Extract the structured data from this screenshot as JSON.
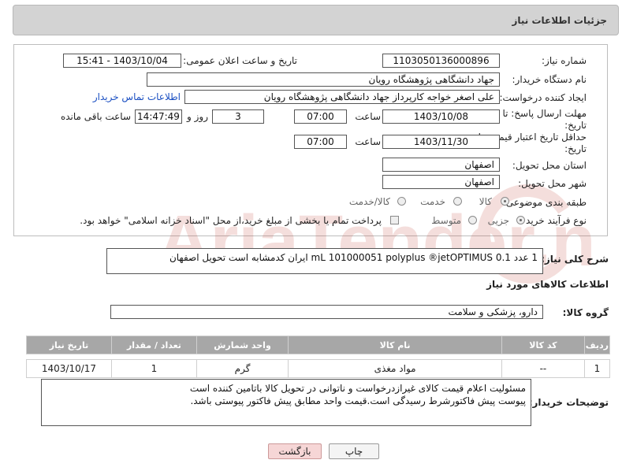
{
  "header": {
    "title": "جزئیات اطلاعات نیاز"
  },
  "form": {
    "need_number_label": "شماره نیاز:",
    "need_number": "1103050136000896",
    "announce_datetime_label": "تاریخ و ساعت اعلان عمومی:",
    "announce_datetime": "1403/10/04 - 15:41",
    "buyer_org_label": "نام دستگاه خریدار:",
    "buyer_org": "جهاد دانشگاهی پژوهشگاه رویان",
    "creator_label": "ایجاد کننده درخواست:",
    "creator": "علی اصغر خواجه کارپرداز جهاد دانشگاهی پژوهشگاه رویان",
    "buyer_contact_link": "اطلاعات تماس خریدار",
    "reply_deadline_label": "مهلت ارسال پاسخ: تا تاریخ:",
    "reply_date": "1403/10/08",
    "time_label": "ساعت",
    "reply_time": "07:00",
    "days_value": "3",
    "days_label": "روز و",
    "remaining_time": "14:47:49",
    "remaining_label": "ساعت باقی مانده",
    "price_validity_label": "حداقل تاریخ اعتبار قیمت: تا تاریخ:",
    "price_date": "1403/11/30",
    "price_time": "07:00",
    "province_label": "استان محل تحویل:",
    "province": "اصفهان",
    "city_label": "شهر محل تحویل:",
    "city": "اصفهان",
    "category_label": "طبقه بندی موضوعی:",
    "category_options": [
      "کالا",
      "خدمت",
      "کالا/خدمت"
    ],
    "category_selected": "کالا",
    "purchase_type_label": "نوع فرآیند خرید :",
    "purchase_options": [
      "جزیی",
      "متوسط"
    ],
    "purchase_selected": "جزیی",
    "payment_note": "پرداخت تمام یا بخشی از مبلغ خرید،از محل \"اسناد خزانه اسلامی\" خواهد بود."
  },
  "description": {
    "label": "شرح کلی نیاز:",
    "text": "1 عدد       0.1 mL      101000051       polyplus     ®jetOPTIMUS   ایران کدمشابه است   تحویل اصفهان"
  },
  "goods_info": {
    "title": "اطلاعات کالاهای مورد نیاز",
    "group_label": "گروه کالا:",
    "group_value": "دارو، پزشکی و سلامت",
    "table": {
      "headers": [
        "ردیف",
        "کد کالا",
        "نام کالا",
        "واحد شمارش",
        "تعداد / مقدار",
        "تاریخ نیاز"
      ],
      "rows": [
        [
          "1",
          "--",
          "مواد مغذی",
          "گرم",
          "1",
          "1403/10/17"
        ]
      ]
    }
  },
  "buyer_notes": {
    "label": "توضیحات خریدار:",
    "lines": [
      "مسئولیت اعلام قیمت کالای غیرازدرخواست و ناتوانی در تحویل کالا باتامین کننده است",
      "پیوست پیش فاکتورشرط رسیدگی است.قیمت واحد مطابق پیش فاکتور پیوستی باشد."
    ]
  },
  "buttons": {
    "print": "چاپ",
    "back": "بازگشت"
  },
  "watermark_text": "AriaTender.neT",
  "colors": {
    "link": "#1a4fc2",
    "table_header": "#a7a7a7",
    "back_button": "#f6d6d6",
    "watermark": "#c0392b"
  }
}
